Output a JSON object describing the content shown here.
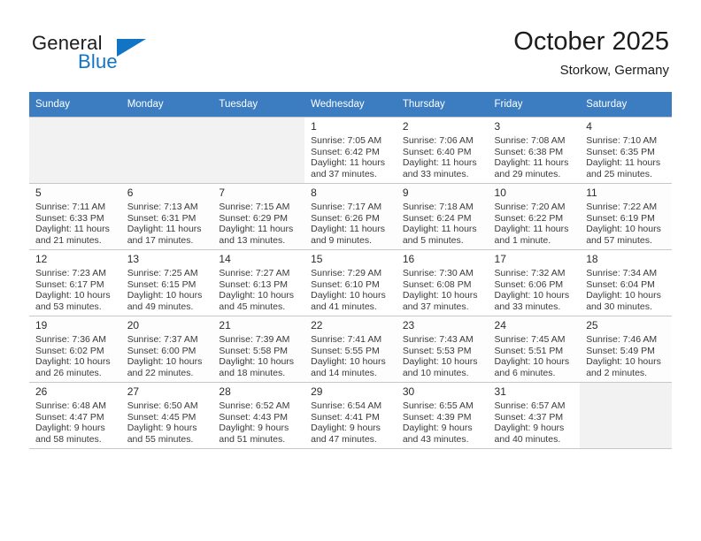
{
  "brand": {
    "name_top": "General",
    "name_bottom": "Blue",
    "accent_color": "#1274c4"
  },
  "header": {
    "title": "October 2025",
    "subtitle": "Storkow, Germany"
  },
  "calendar": {
    "header_bg": "#3b7dc0",
    "weekday_headers": [
      "Sunday",
      "Monday",
      "Tuesday",
      "Wednesday",
      "Thursday",
      "Friday",
      "Saturday"
    ],
    "weeks": [
      [
        {
          "day": "",
          "sunrise": "",
          "sunset": "",
          "daylight_line1": "",
          "daylight_line2": "",
          "empty": true
        },
        {
          "day": "",
          "sunrise": "",
          "sunset": "",
          "daylight_line1": "",
          "daylight_line2": "",
          "empty": true
        },
        {
          "day": "",
          "sunrise": "",
          "sunset": "",
          "daylight_line1": "",
          "daylight_line2": "",
          "empty": true
        },
        {
          "day": "1",
          "sunrise": "Sunrise: 7:05 AM",
          "sunset": "Sunset: 6:42 PM",
          "daylight_line1": "Daylight: 11 hours",
          "daylight_line2": "and 37 minutes."
        },
        {
          "day": "2",
          "sunrise": "Sunrise: 7:06 AM",
          "sunset": "Sunset: 6:40 PM",
          "daylight_line1": "Daylight: 11 hours",
          "daylight_line2": "and 33 minutes."
        },
        {
          "day": "3",
          "sunrise": "Sunrise: 7:08 AM",
          "sunset": "Sunset: 6:38 PM",
          "daylight_line1": "Daylight: 11 hours",
          "daylight_line2": "and 29 minutes."
        },
        {
          "day": "4",
          "sunrise": "Sunrise: 7:10 AM",
          "sunset": "Sunset: 6:35 PM",
          "daylight_line1": "Daylight: 11 hours",
          "daylight_line2": "and 25 minutes."
        }
      ],
      [
        {
          "day": "5",
          "sunrise": "Sunrise: 7:11 AM",
          "sunset": "Sunset: 6:33 PM",
          "daylight_line1": "Daylight: 11 hours",
          "daylight_line2": "and 21 minutes."
        },
        {
          "day": "6",
          "sunrise": "Sunrise: 7:13 AM",
          "sunset": "Sunset: 6:31 PM",
          "daylight_line1": "Daylight: 11 hours",
          "daylight_line2": "and 17 minutes."
        },
        {
          "day": "7",
          "sunrise": "Sunrise: 7:15 AM",
          "sunset": "Sunset: 6:29 PM",
          "daylight_line1": "Daylight: 11 hours",
          "daylight_line2": "and 13 minutes."
        },
        {
          "day": "8",
          "sunrise": "Sunrise: 7:17 AM",
          "sunset": "Sunset: 6:26 PM",
          "daylight_line1": "Daylight: 11 hours",
          "daylight_line2": "and 9 minutes."
        },
        {
          "day": "9",
          "sunrise": "Sunrise: 7:18 AM",
          "sunset": "Sunset: 6:24 PM",
          "daylight_line1": "Daylight: 11 hours",
          "daylight_line2": "and 5 minutes."
        },
        {
          "day": "10",
          "sunrise": "Sunrise: 7:20 AM",
          "sunset": "Sunset: 6:22 PM",
          "daylight_line1": "Daylight: 11 hours",
          "daylight_line2": "and 1 minute."
        },
        {
          "day": "11",
          "sunrise": "Sunrise: 7:22 AM",
          "sunset": "Sunset: 6:19 PM",
          "daylight_line1": "Daylight: 10 hours",
          "daylight_line2": "and 57 minutes."
        }
      ],
      [
        {
          "day": "12",
          "sunrise": "Sunrise: 7:23 AM",
          "sunset": "Sunset: 6:17 PM",
          "daylight_line1": "Daylight: 10 hours",
          "daylight_line2": "and 53 minutes."
        },
        {
          "day": "13",
          "sunrise": "Sunrise: 7:25 AM",
          "sunset": "Sunset: 6:15 PM",
          "daylight_line1": "Daylight: 10 hours",
          "daylight_line2": "and 49 minutes."
        },
        {
          "day": "14",
          "sunrise": "Sunrise: 7:27 AM",
          "sunset": "Sunset: 6:13 PM",
          "daylight_line1": "Daylight: 10 hours",
          "daylight_line2": "and 45 minutes."
        },
        {
          "day": "15",
          "sunrise": "Sunrise: 7:29 AM",
          "sunset": "Sunset: 6:10 PM",
          "daylight_line1": "Daylight: 10 hours",
          "daylight_line2": "and 41 minutes."
        },
        {
          "day": "16",
          "sunrise": "Sunrise: 7:30 AM",
          "sunset": "Sunset: 6:08 PM",
          "daylight_line1": "Daylight: 10 hours",
          "daylight_line2": "and 37 minutes."
        },
        {
          "day": "17",
          "sunrise": "Sunrise: 7:32 AM",
          "sunset": "Sunset: 6:06 PM",
          "daylight_line1": "Daylight: 10 hours",
          "daylight_line2": "and 33 minutes."
        },
        {
          "day": "18",
          "sunrise": "Sunrise: 7:34 AM",
          "sunset": "Sunset: 6:04 PM",
          "daylight_line1": "Daylight: 10 hours",
          "daylight_line2": "and 30 minutes."
        }
      ],
      [
        {
          "day": "19",
          "sunrise": "Sunrise: 7:36 AM",
          "sunset": "Sunset: 6:02 PM",
          "daylight_line1": "Daylight: 10 hours",
          "daylight_line2": "and 26 minutes."
        },
        {
          "day": "20",
          "sunrise": "Sunrise: 7:37 AM",
          "sunset": "Sunset: 6:00 PM",
          "daylight_line1": "Daylight: 10 hours",
          "daylight_line2": "and 22 minutes."
        },
        {
          "day": "21",
          "sunrise": "Sunrise: 7:39 AM",
          "sunset": "Sunset: 5:58 PM",
          "daylight_line1": "Daylight: 10 hours",
          "daylight_line2": "and 18 minutes."
        },
        {
          "day": "22",
          "sunrise": "Sunrise: 7:41 AM",
          "sunset": "Sunset: 5:55 PM",
          "daylight_line1": "Daylight: 10 hours",
          "daylight_line2": "and 14 minutes."
        },
        {
          "day": "23",
          "sunrise": "Sunrise: 7:43 AM",
          "sunset": "Sunset: 5:53 PM",
          "daylight_line1": "Daylight: 10 hours",
          "daylight_line2": "and 10 minutes."
        },
        {
          "day": "24",
          "sunrise": "Sunrise: 7:45 AM",
          "sunset": "Sunset: 5:51 PM",
          "daylight_line1": "Daylight: 10 hours",
          "daylight_line2": "and 6 minutes."
        },
        {
          "day": "25",
          "sunrise": "Sunrise: 7:46 AM",
          "sunset": "Sunset: 5:49 PM",
          "daylight_line1": "Daylight: 10 hours",
          "daylight_line2": "and 2 minutes."
        }
      ],
      [
        {
          "day": "26",
          "sunrise": "Sunrise: 6:48 AM",
          "sunset": "Sunset: 4:47 PM",
          "daylight_line1": "Daylight: 9 hours",
          "daylight_line2": "and 58 minutes."
        },
        {
          "day": "27",
          "sunrise": "Sunrise: 6:50 AM",
          "sunset": "Sunset: 4:45 PM",
          "daylight_line1": "Daylight: 9 hours",
          "daylight_line2": "and 55 minutes."
        },
        {
          "day": "28",
          "sunrise": "Sunrise: 6:52 AM",
          "sunset": "Sunset: 4:43 PM",
          "daylight_line1": "Daylight: 9 hours",
          "daylight_line2": "and 51 minutes."
        },
        {
          "day": "29",
          "sunrise": "Sunrise: 6:54 AM",
          "sunset": "Sunset: 4:41 PM",
          "daylight_line1": "Daylight: 9 hours",
          "daylight_line2": "and 47 minutes."
        },
        {
          "day": "30",
          "sunrise": "Sunrise: 6:55 AM",
          "sunset": "Sunset: 4:39 PM",
          "daylight_line1": "Daylight: 9 hours",
          "daylight_line2": "and 43 minutes."
        },
        {
          "day": "31",
          "sunrise": "Sunrise: 6:57 AM",
          "sunset": "Sunset: 4:37 PM",
          "daylight_line1": "Daylight: 9 hours",
          "daylight_line2": "and 40 minutes."
        },
        {
          "day": "",
          "sunrise": "",
          "sunset": "",
          "daylight_line1": "",
          "daylight_line2": "",
          "empty": true
        }
      ]
    ]
  }
}
